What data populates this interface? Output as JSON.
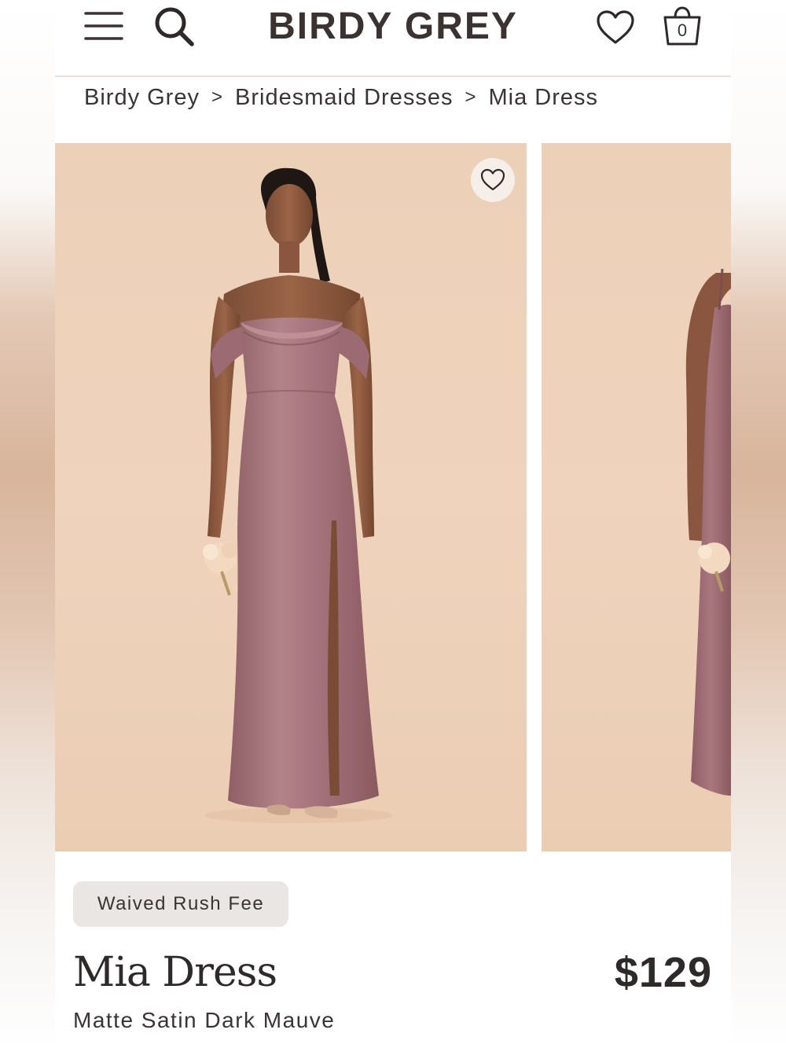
{
  "header": {
    "logo": "BIRDY GREY",
    "bag_count": "0"
  },
  "breadcrumb": [
    {
      "label": "Birdy Grey"
    },
    {
      "label": "Bridesmaid Dresses"
    },
    {
      "label": "Mia Dress"
    }
  ],
  "breadcrumb_separator": ">",
  "product": {
    "badge": "Waived Rush Fee",
    "name": "Mia Dress",
    "price": "$129",
    "variant": "Matte Satin Dark Mauve"
  },
  "colors": {
    "photo_background": "#efd3bc",
    "dress": "#a7727a",
    "badge_background": "#eae6e3",
    "text": "#3a3434"
  }
}
